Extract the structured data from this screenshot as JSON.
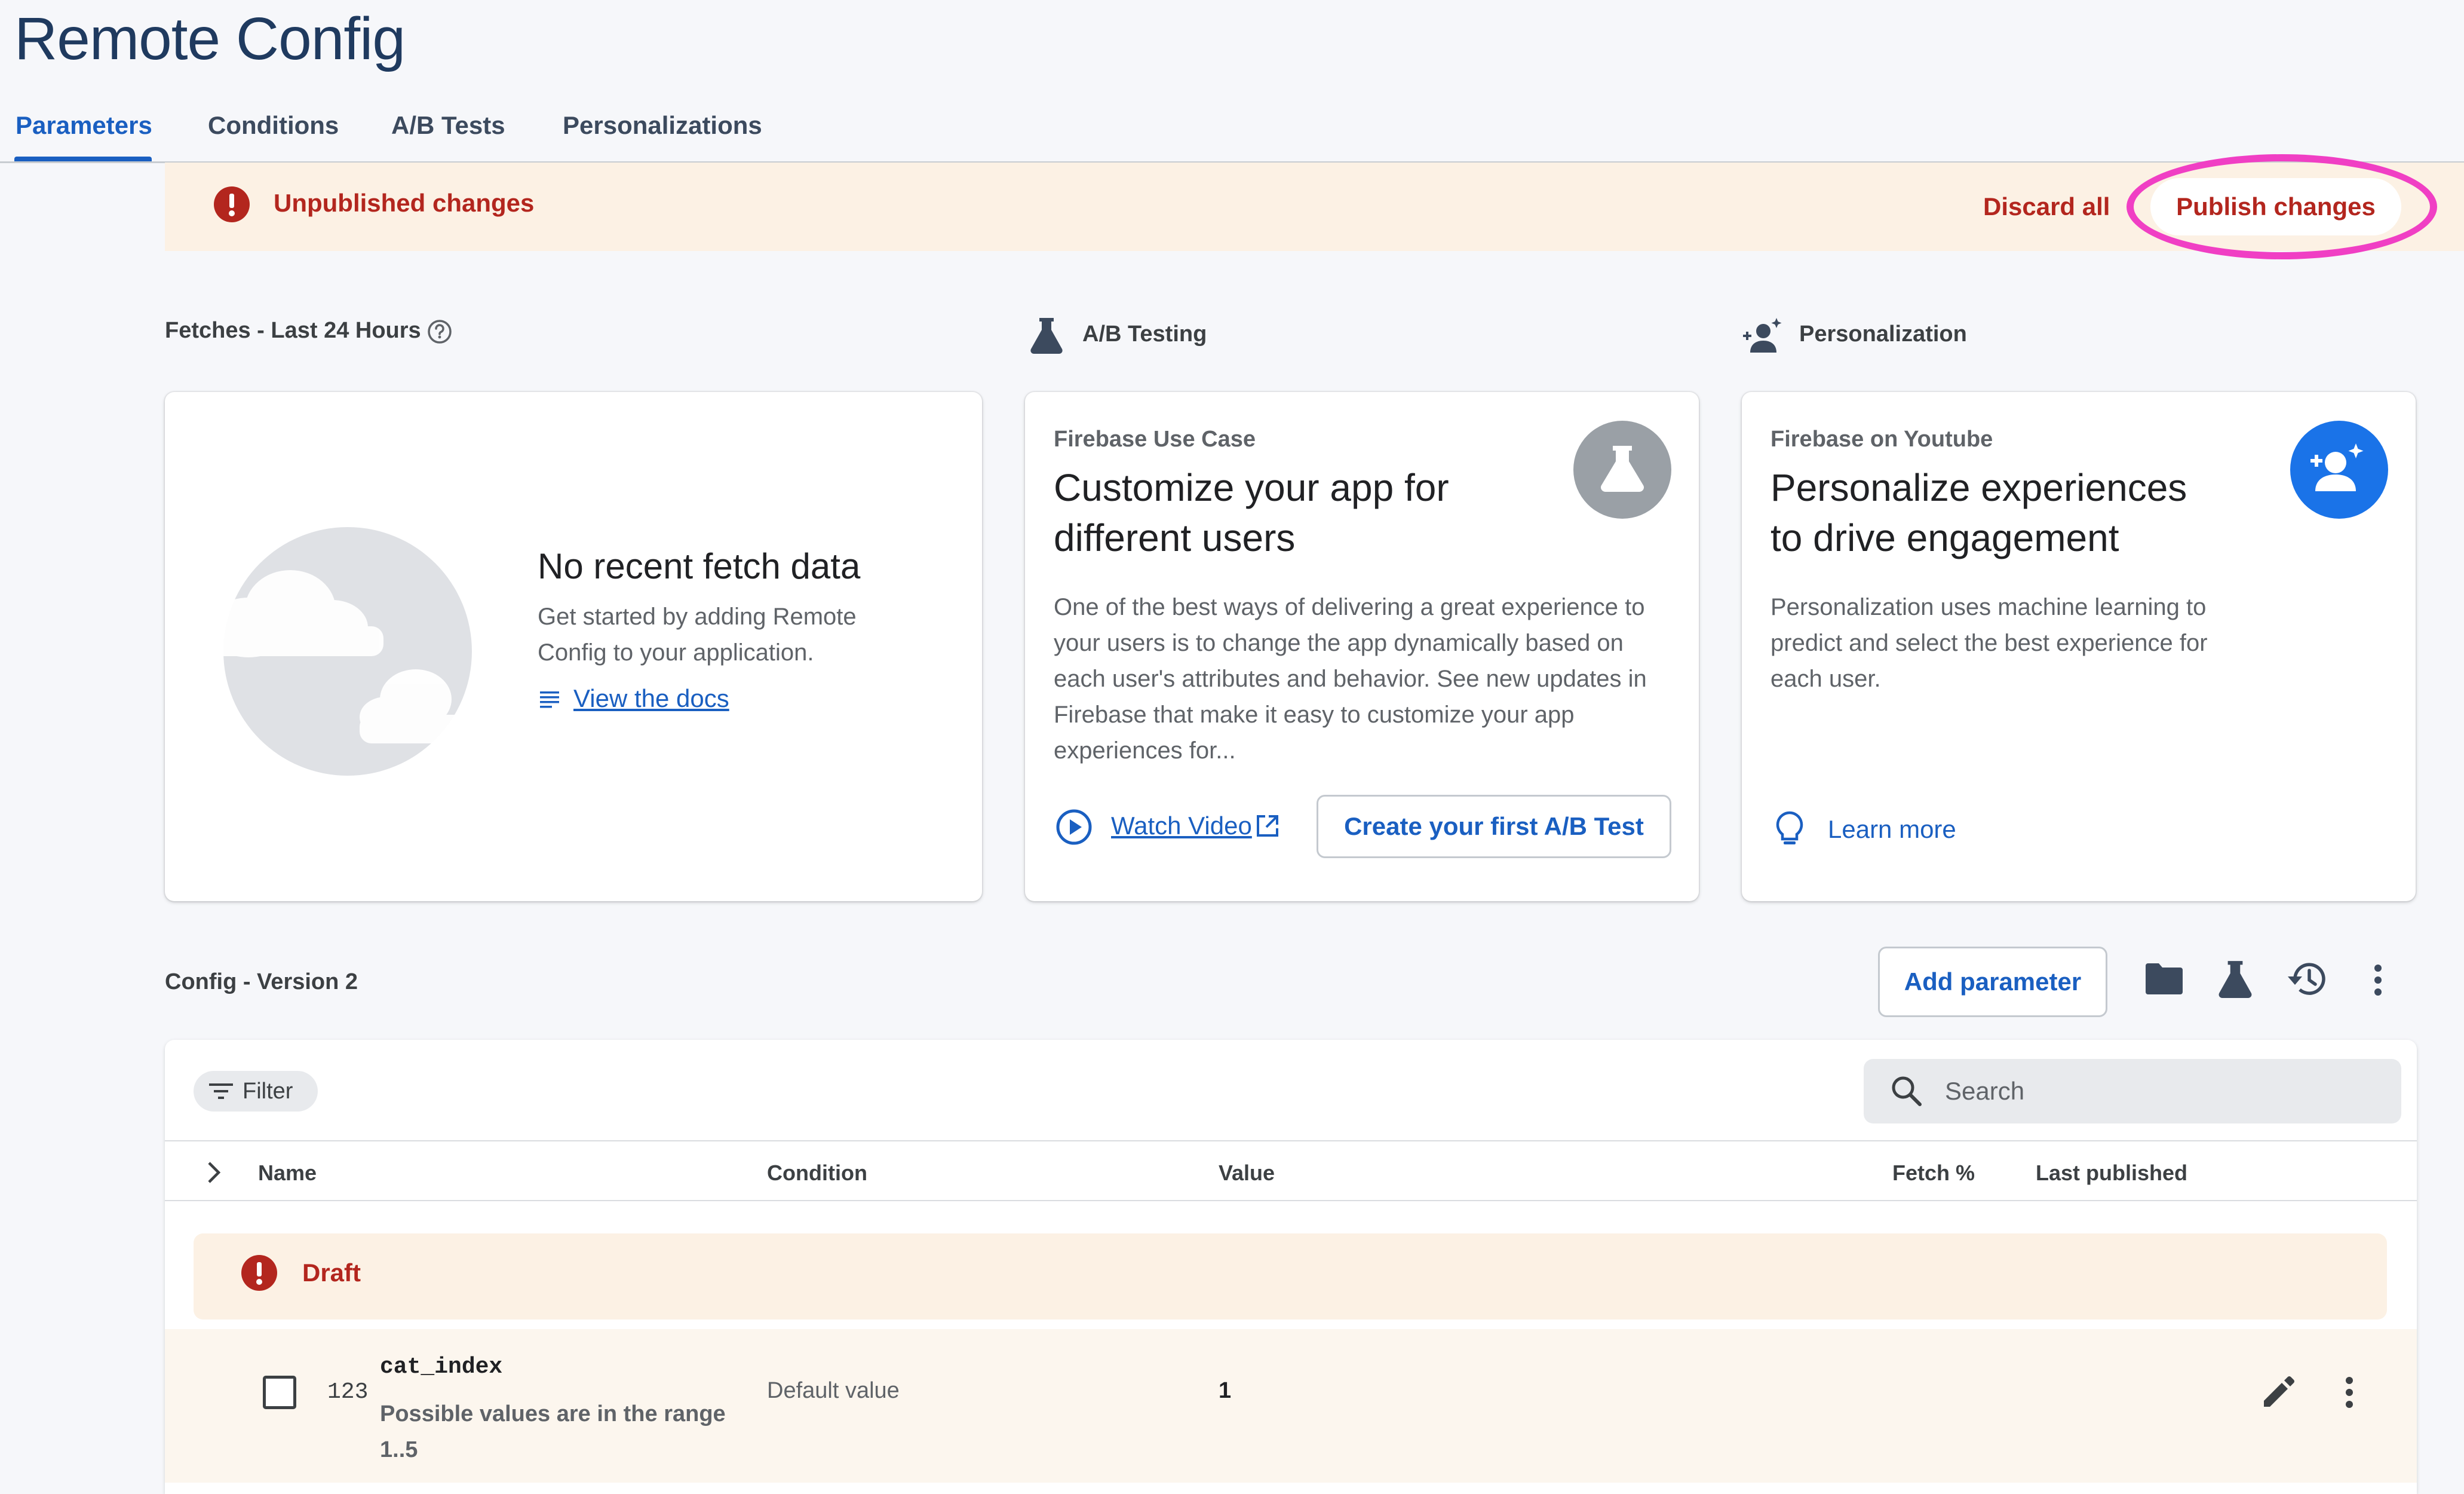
{
  "page": {
    "title": "Remote Config"
  },
  "tabs": [
    {
      "label": "Parameters",
      "active": true
    },
    {
      "label": "Conditions",
      "active": false
    },
    {
      "label": "A/B Tests",
      "active": false
    },
    {
      "label": "Personalizations",
      "active": false
    }
  ],
  "banner": {
    "message": "Unpublished changes",
    "discard_label": "Discard all",
    "publish_label": "Publish changes"
  },
  "sections": {
    "fetches": "Fetches - Last 24 Hours",
    "ab_testing": "A/B Testing",
    "personalization": "Personalization"
  },
  "fetch_card": {
    "title": "No recent fetch data",
    "body": "Get started by adding Remote Config to your application.",
    "link": "View the docs"
  },
  "ab_card": {
    "eyebrow": "Firebase Use Case",
    "title": "Customize your app for different users",
    "body": "One of the best ways of delivering a great experience to your users is to change the app dynamically based on each user's attributes and behavior. See new updates in Firebase that make it easy to customize your app experiences for...",
    "watch_video": "Watch Video",
    "create_test": "Create your first A/B Test"
  },
  "personalization_card": {
    "eyebrow": "Firebase on Youtube",
    "title": "Personalize experiences to drive engagement",
    "body": "Personalization uses machine learning to predict and select the best experience for each user.",
    "learn_more": "Learn more"
  },
  "config": {
    "label": "Config - Version 2",
    "add_parameter": "Add parameter",
    "filter": "Filter",
    "search_placeholder": "Search",
    "columns": {
      "name": "Name",
      "condition": "Condition",
      "value": "Value",
      "fetch": "Fetch %",
      "last_published": "Last published"
    },
    "draft_label": "Draft",
    "rows": [
      {
        "type_icon": "123",
        "name": "cat_index",
        "description": "Possible values are in the range 1..5",
        "condition": "Default value",
        "value": "1"
      }
    ]
  },
  "colors": {
    "accent": "#1a5fc1",
    "warning": "#b3261e",
    "banner_bg": "#fcf1e4",
    "highlight": "#f03fc4",
    "title": "#1f3a5f"
  }
}
